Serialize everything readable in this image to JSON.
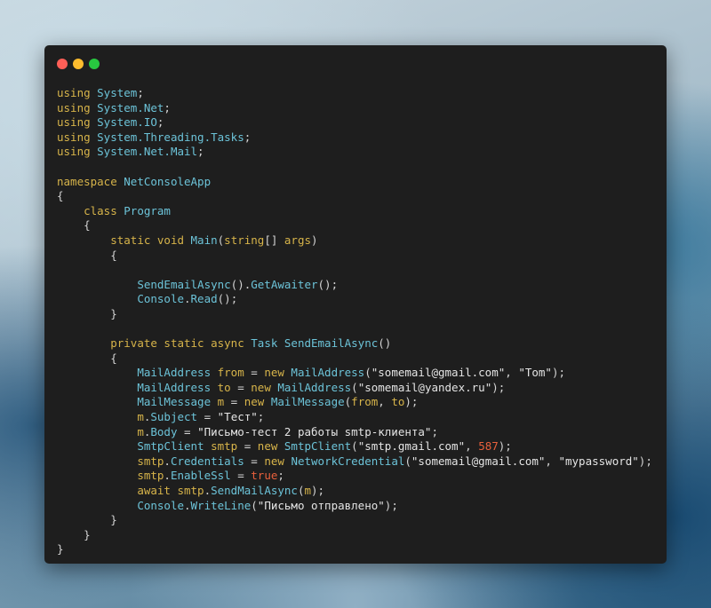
{
  "window": {
    "controls": [
      "close",
      "minimize",
      "maximize"
    ]
  },
  "colors": {
    "keyword": "#d7b44a",
    "type": "#6cc3d8",
    "plain": "#d4d4d4",
    "string": "#e4e4e4",
    "number": "#e8603c",
    "background": "#1e1e1e"
  },
  "code_lines": [
    [
      [
        "kw",
        "using "
      ],
      [
        "ty",
        "System"
      ],
      [
        "pl",
        ";"
      ]
    ],
    [
      [
        "kw",
        "using "
      ],
      [
        "ty",
        "System.Net"
      ],
      [
        "pl",
        ";"
      ]
    ],
    [
      [
        "kw",
        "using "
      ],
      [
        "ty",
        "System.IO"
      ],
      [
        "pl",
        ";"
      ]
    ],
    [
      [
        "kw",
        "using "
      ],
      [
        "ty",
        "System.Threading.Tasks"
      ],
      [
        "pl",
        ";"
      ]
    ],
    [
      [
        "kw",
        "using "
      ],
      [
        "ty",
        "System.Net.Mail"
      ],
      [
        "pl",
        ";"
      ]
    ],
    [],
    [
      [
        "kw",
        "namespace "
      ],
      [
        "ty",
        "NetConsoleApp"
      ]
    ],
    [
      [
        "pl",
        "{"
      ]
    ],
    [
      [
        "pl",
        "    "
      ],
      [
        "kw",
        "class "
      ],
      [
        "ty",
        "Program"
      ]
    ],
    [
      [
        "pl",
        "    {"
      ]
    ],
    [
      [
        "pl",
        "        "
      ],
      [
        "kw",
        "static void "
      ],
      [
        "ty",
        "Main"
      ],
      [
        "pl",
        "("
      ],
      [
        "kw",
        "string"
      ],
      [
        "pl",
        "[] "
      ],
      [
        "kw",
        "args"
      ],
      [
        "pl",
        ")"
      ]
    ],
    [
      [
        "pl",
        "        {"
      ]
    ],
    [],
    [
      [
        "pl",
        "            "
      ],
      [
        "ty",
        "SendEmailAsync"
      ],
      [
        "pl",
        "()."
      ],
      [
        "ty",
        "GetAwaiter"
      ],
      [
        "pl",
        "();"
      ]
    ],
    [
      [
        "pl",
        "            "
      ],
      [
        "ty",
        "Console"
      ],
      [
        "pl",
        "."
      ],
      [
        "ty",
        "Read"
      ],
      [
        "pl",
        "();"
      ]
    ],
    [
      [
        "pl",
        "        }"
      ]
    ],
    [],
    [
      [
        "pl",
        "        "
      ],
      [
        "kw",
        "private static async "
      ],
      [
        "ty",
        "Task SendEmailAsync"
      ],
      [
        "pl",
        "()"
      ]
    ],
    [
      [
        "pl",
        "        {"
      ]
    ],
    [
      [
        "pl",
        "            "
      ],
      [
        "ty",
        "MailAddress "
      ],
      [
        "kw",
        "from"
      ],
      [
        "pl",
        " = "
      ],
      [
        "kw",
        "new "
      ],
      [
        "ty",
        "MailAddress"
      ],
      [
        "pl",
        "("
      ],
      [
        "st",
        "\"somemail@gmail.com\""
      ],
      [
        "pl",
        ", "
      ],
      [
        "st",
        "\"Tom\""
      ],
      [
        "pl",
        ");"
      ]
    ],
    [
      [
        "pl",
        "            "
      ],
      [
        "ty",
        "MailAddress "
      ],
      [
        "kw",
        "to"
      ],
      [
        "pl",
        " = "
      ],
      [
        "kw",
        "new "
      ],
      [
        "ty",
        "MailAddress"
      ],
      [
        "pl",
        "("
      ],
      [
        "st",
        "\"somemail@yandex.ru\""
      ],
      [
        "pl",
        ");"
      ]
    ],
    [
      [
        "pl",
        "            "
      ],
      [
        "ty",
        "MailMessage "
      ],
      [
        "kw",
        "m"
      ],
      [
        "pl",
        " = "
      ],
      [
        "kw",
        "new "
      ],
      [
        "ty",
        "MailMessage"
      ],
      [
        "pl",
        "("
      ],
      [
        "kw",
        "from"
      ],
      [
        "pl",
        ", "
      ],
      [
        "kw",
        "to"
      ],
      [
        "pl",
        ");"
      ]
    ],
    [
      [
        "pl",
        "            "
      ],
      [
        "kw",
        "m"
      ],
      [
        "pl",
        "."
      ],
      [
        "ty",
        "Subject"
      ],
      [
        "pl",
        " = "
      ],
      [
        "st",
        "\"Тест\""
      ],
      [
        "pl",
        ";"
      ]
    ],
    [
      [
        "pl",
        "            "
      ],
      [
        "kw",
        "m"
      ],
      [
        "pl",
        "."
      ],
      [
        "ty",
        "Body"
      ],
      [
        "pl",
        " = "
      ],
      [
        "st",
        "\"Письмо-тест 2 работы smtp-клиента\""
      ],
      [
        "pl",
        ";"
      ]
    ],
    [
      [
        "pl",
        "            "
      ],
      [
        "ty",
        "SmtpClient "
      ],
      [
        "kw",
        "smtp"
      ],
      [
        "pl",
        " = "
      ],
      [
        "kw",
        "new "
      ],
      [
        "ty",
        "SmtpClient"
      ],
      [
        "pl",
        "("
      ],
      [
        "st",
        "\"smtp.gmail.com\""
      ],
      [
        "pl",
        ", "
      ],
      [
        "nm",
        "587"
      ],
      [
        "pl",
        ");"
      ]
    ],
    [
      [
        "pl",
        "            "
      ],
      [
        "kw",
        "smtp"
      ],
      [
        "pl",
        "."
      ],
      [
        "ty",
        "Credentials"
      ],
      [
        "pl",
        " = "
      ],
      [
        "kw",
        "new "
      ],
      [
        "ty",
        "NetworkCredential"
      ],
      [
        "pl",
        "("
      ],
      [
        "st",
        "\"somemail@gmail.com\""
      ],
      [
        "pl",
        ", "
      ],
      [
        "st",
        "\"mypassword\""
      ],
      [
        "pl",
        ");"
      ]
    ],
    [
      [
        "pl",
        "            "
      ],
      [
        "kw",
        "smtp"
      ],
      [
        "pl",
        "."
      ],
      [
        "ty",
        "EnableSsl"
      ],
      [
        "pl",
        " = "
      ],
      [
        "bl",
        "true"
      ],
      [
        "pl",
        ";"
      ]
    ],
    [
      [
        "pl",
        "            "
      ],
      [
        "kw",
        "await "
      ],
      [
        "kw",
        "smtp"
      ],
      [
        "pl",
        "."
      ],
      [
        "ty",
        "SendMailAsync"
      ],
      [
        "pl",
        "("
      ],
      [
        "kw",
        "m"
      ],
      [
        "pl",
        ");"
      ]
    ],
    [
      [
        "pl",
        "            "
      ],
      [
        "ty",
        "Console"
      ],
      [
        "pl",
        "."
      ],
      [
        "ty",
        "WriteLine"
      ],
      [
        "pl",
        "("
      ],
      [
        "st",
        "\"Письмо отправлено\""
      ],
      [
        "pl",
        ");"
      ]
    ],
    [
      [
        "pl",
        "        }"
      ]
    ],
    [
      [
        "pl",
        "    }"
      ]
    ],
    [
      [
        "pl",
        "}"
      ]
    ]
  ]
}
